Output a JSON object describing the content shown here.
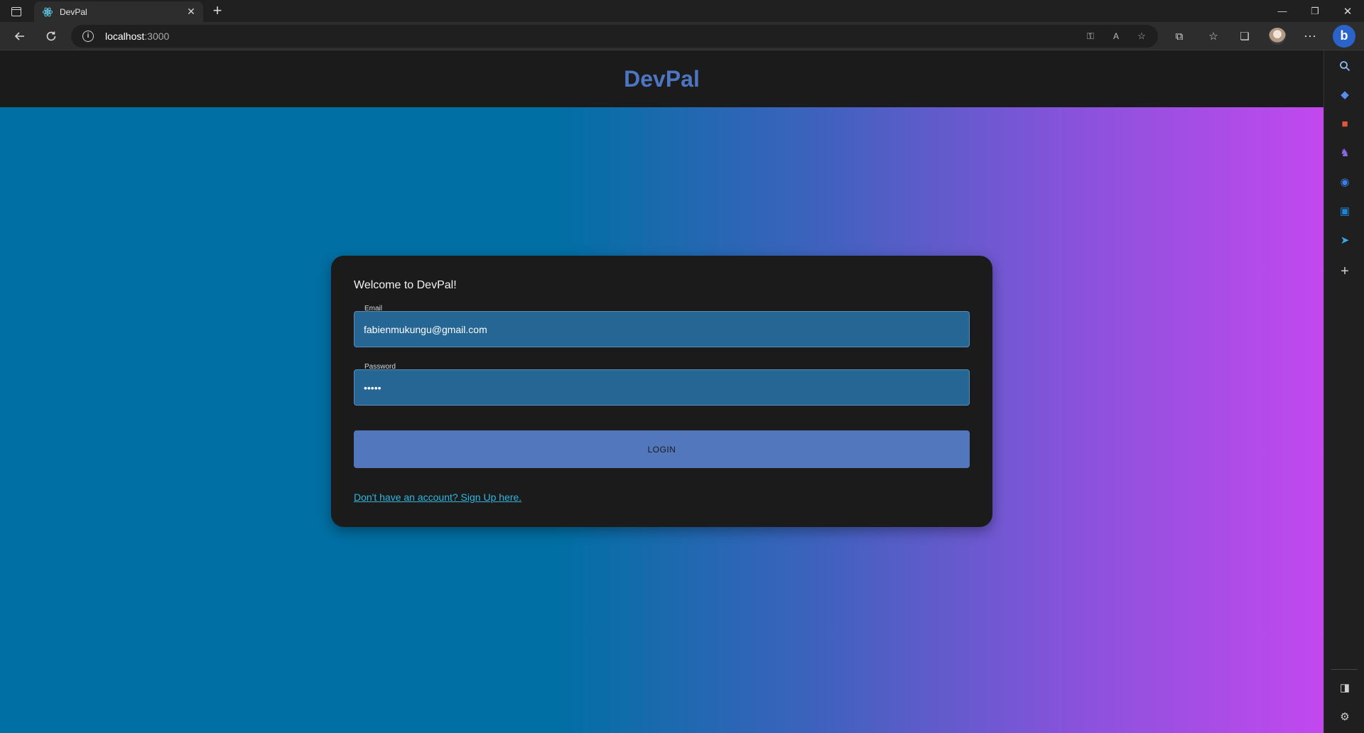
{
  "browser": {
    "tab_title": "DevPal",
    "tab_close_glyph": "✕",
    "new_tab_glyph": "+",
    "address": {
      "host": "localhost",
      "port": ":3000"
    },
    "window_controls": {
      "minimize": "—",
      "restore": "❐",
      "close": "✕"
    }
  },
  "header": {
    "brand": "DevPal"
  },
  "login_card": {
    "title": "Welcome to DevPal!",
    "email": {
      "label": "Email",
      "value": "fabienmukungu@gmail.com"
    },
    "password": {
      "label": "Password",
      "value": "•••••"
    },
    "login_button": "LOGIN",
    "signup_link": "Don't have an account? Sign Up here."
  },
  "colors": {
    "brand": "#4d75c2",
    "field_bg": "#256695",
    "button_bg": "#5277bd",
    "link": "#2fb6e0",
    "gradient_start": "#006fa3",
    "gradient_end": "#c248ef"
  }
}
